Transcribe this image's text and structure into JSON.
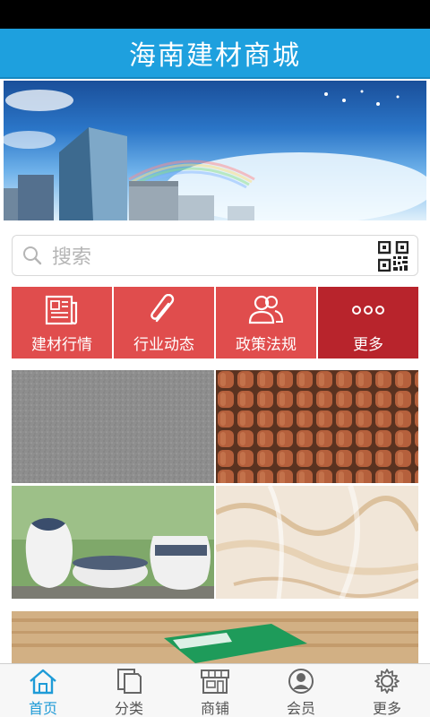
{
  "header": {
    "title": "海南建材商城"
  },
  "search": {
    "placeholder": "搜索",
    "icon": "search-icon",
    "qr_icon": "qr-code-icon"
  },
  "menu": [
    {
      "label": "建材行情",
      "icon": "newspaper-icon",
      "color": "#e04d4d"
    },
    {
      "label": "行业动态",
      "icon": "paperclip-icon",
      "color": "#e04d4d"
    },
    {
      "label": "政策法规",
      "icon": "users-icon",
      "color": "#e04d4d"
    },
    {
      "label": "更多",
      "icon": "more-dots-icon",
      "color": "#b8242c"
    }
  ],
  "tabs": [
    {
      "label": "首页",
      "icon": "home-icon",
      "active": true
    },
    {
      "label": "分类",
      "icon": "documents-icon",
      "active": false
    },
    {
      "label": "商铺",
      "icon": "store-icon",
      "active": false
    },
    {
      "label": "会员",
      "icon": "user-icon",
      "active": false
    },
    {
      "label": "更多",
      "icon": "gear-icon",
      "active": false
    }
  ],
  "colors": {
    "header": "#1ea0de",
    "menu_red": "#e04d4d",
    "menu_dark_red": "#b8242c",
    "tab_active": "#1e9bd7"
  }
}
